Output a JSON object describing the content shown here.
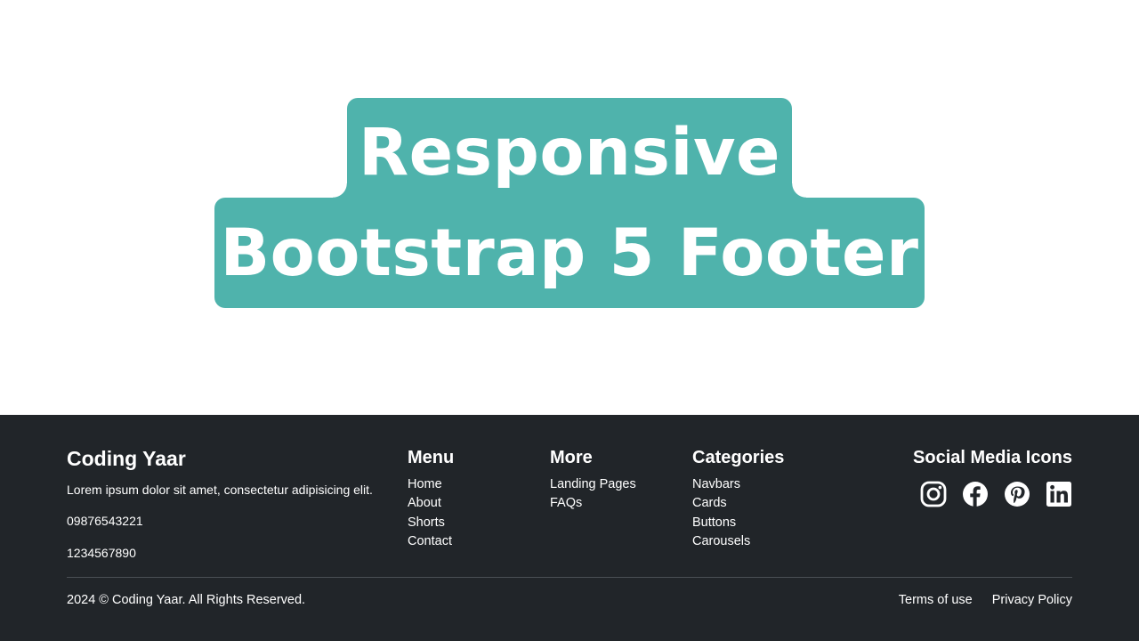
{
  "hero": {
    "line1": "Responsive",
    "line2": "Bootstrap 5 Footer",
    "accent_color": "#4fb3ac"
  },
  "footer": {
    "background": "#212529",
    "brand": "Coding Yaar",
    "description": "Lorem ipsum dolor sit amet, consectetur adipisicing elit.",
    "phone_1": "09876543221",
    "phone_2": "1234567890",
    "menu": {
      "title": "Menu",
      "items": [
        "Home",
        "About",
        "Shorts",
        "Contact"
      ]
    },
    "more": {
      "title": "More",
      "items": [
        "Landing Pages",
        "FAQs"
      ]
    },
    "categories": {
      "title": "Categories",
      "items": [
        "Navbars",
        "Cards",
        "Buttons",
        "Carousels"
      ]
    },
    "social": {
      "title": "Social Media Icons",
      "icons": [
        "instagram-icon",
        "facebook-icon",
        "pinterest-icon",
        "linkedin-icon"
      ]
    },
    "copyright": "2024 © Coding Yaar. All Rights Reserved.",
    "legal_links": [
      "Terms of use",
      "Privacy Policy"
    ]
  }
}
